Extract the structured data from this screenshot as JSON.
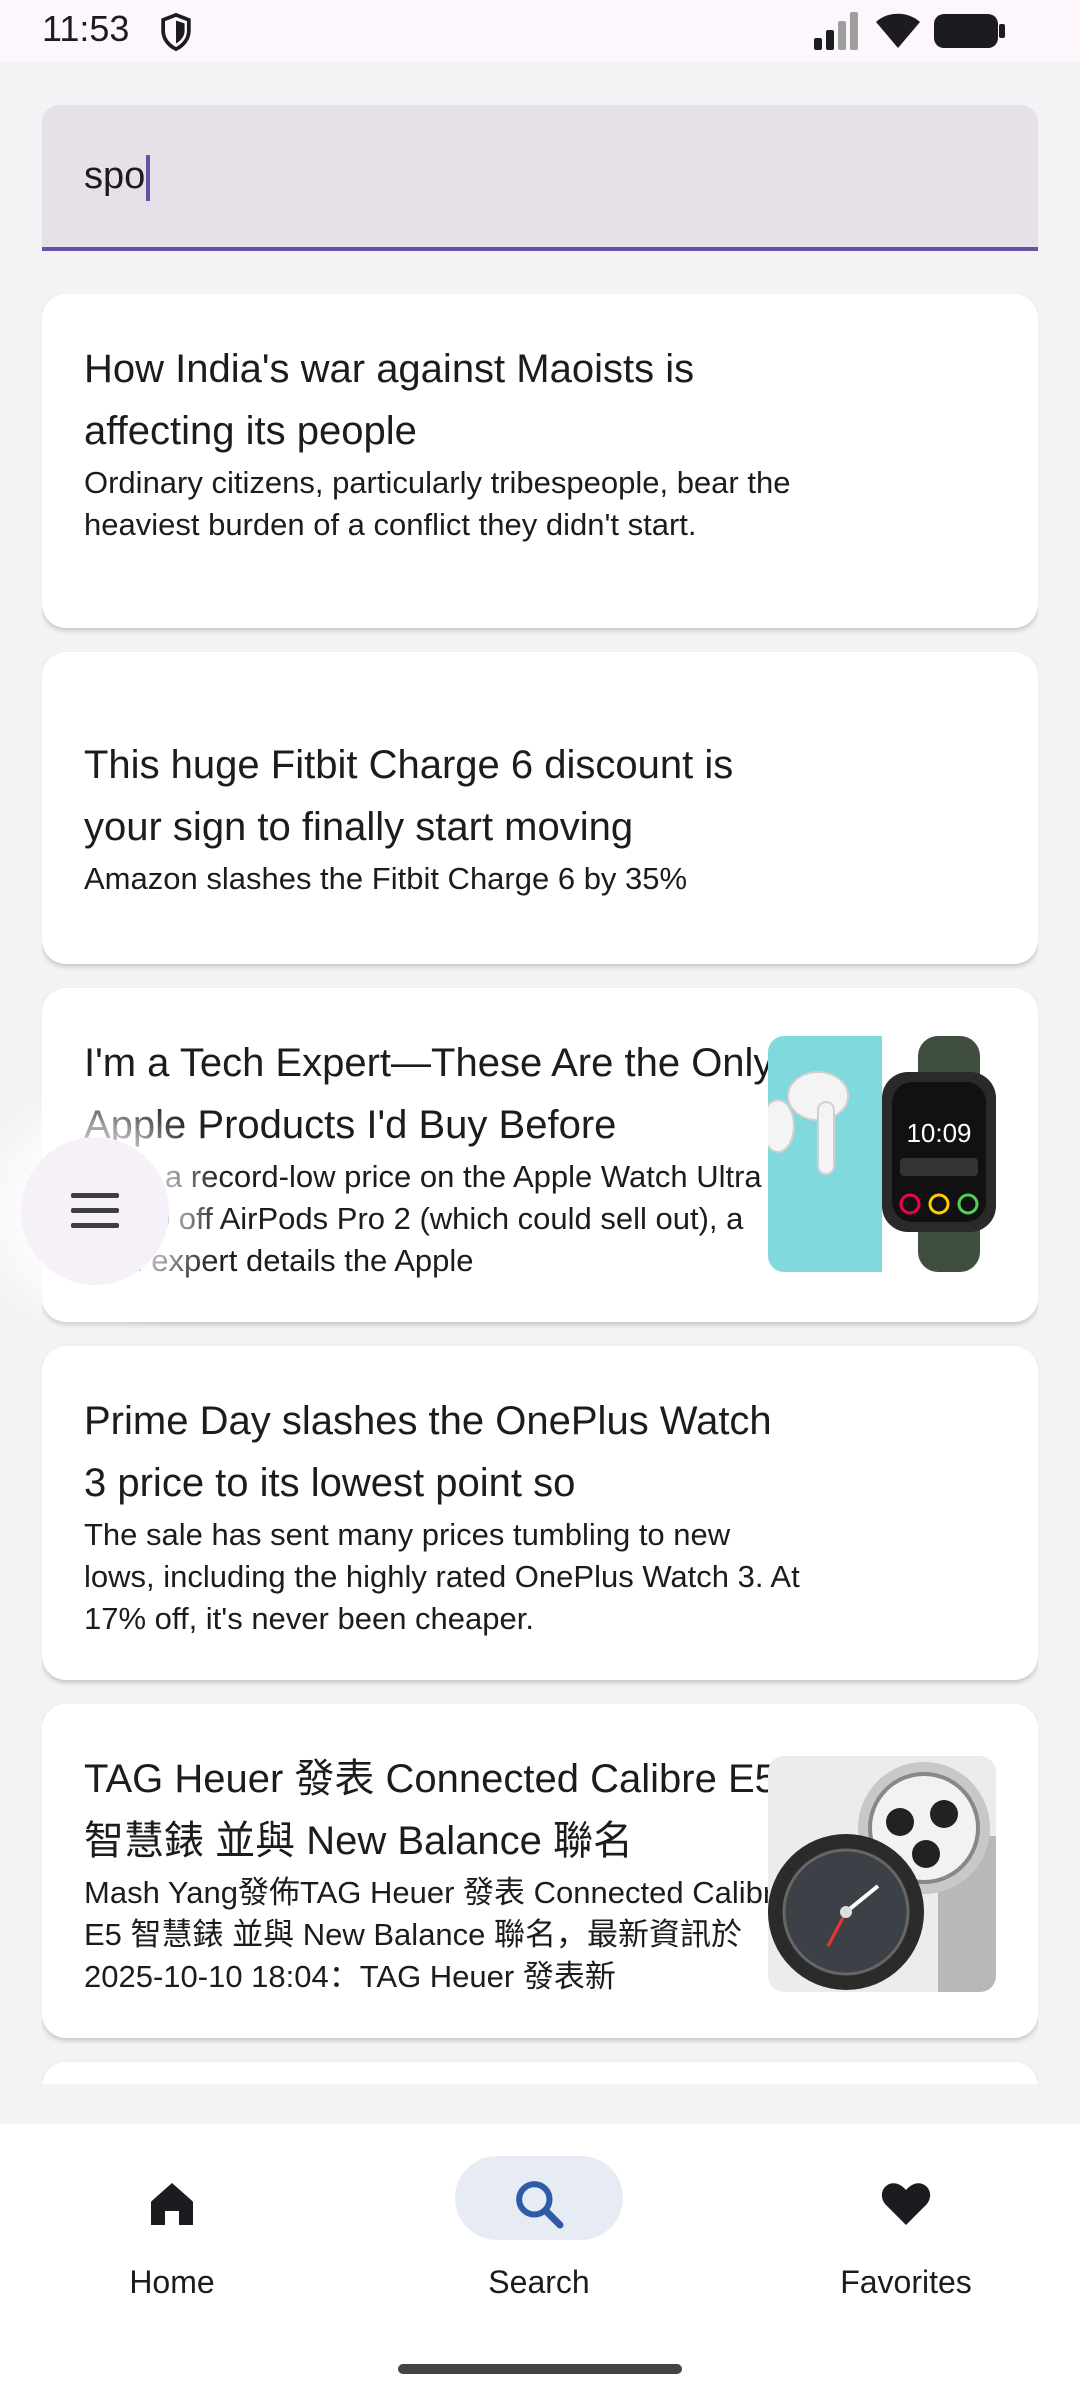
{
  "status_bar": {
    "time": "11:53",
    "icons": [
      "shield-icon",
      "signal-icon",
      "wifi-icon",
      "battery-icon"
    ]
  },
  "search": {
    "value": "spo",
    "accent_color": "#6750a4"
  },
  "results": [
    {
      "title": "How India's war against Maoists is affecting its people",
      "description": "Ordinary citizens, particularly tribespeople, bear the heaviest burden of a conflict they didn't start."
    },
    {
      "title": "This huge Fitbit Charge 6 discount is your sign to finally start moving",
      "description": "Amazon slashes the Fitbit Charge 6 by 35%"
    },
    {
      "title": "I'm a Tech Expert—These Are the Only Apple Products I'd Buy Before",
      "description": "From a record-low price on the Apple Watch Ultra 2 to $50 off AirPods Pro 2 (which could sell out), a tech expert details the Apple",
      "image": "airpods-and-apple-watch-image"
    },
    {
      "title": "Prime Day slashes the OnePlus Watch 3 price to its lowest point so",
      "description": "The sale has sent many prices tumbling to new lows, including the highly rated OnePlus Watch 3. At 17% off, it's never been cheaper."
    },
    {
      "title": "TAG Heuer 發表 Connected Calibre E5 智慧錶 並與 New Balance 聯名",
      "description": "Mash Yang發佈TAG Heuer 發表 Connected Calibre E5 智慧錶 並與 New Balance 聯名，最新資訊於2025-10-10 18:04：TAG Heuer 發表新",
      "image": "tag-heuer-watch-image"
    }
  ],
  "bottom_nav": [
    {
      "label": "Home",
      "icon": "home-icon",
      "active": false
    },
    {
      "label": "Search",
      "icon": "search-icon",
      "active": true
    },
    {
      "label": "Favorites",
      "icon": "heart-icon",
      "active": false
    }
  ]
}
